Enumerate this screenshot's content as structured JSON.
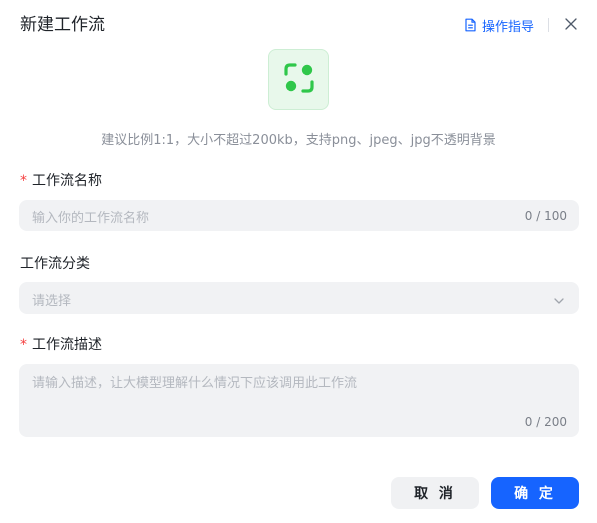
{
  "header": {
    "title": "新建工作流",
    "guide_label": "操作指导"
  },
  "icon": {
    "hint": "建议比例1:1，大小不超过200kb，支持png、jpeg、jpg不透明背景"
  },
  "form": {
    "required_mark": "*",
    "name": {
      "label": "工作流名称",
      "placeholder": "输入你的工作流名称",
      "counter": "0 / 100"
    },
    "category": {
      "label": "工作流分类",
      "placeholder": "请选择"
    },
    "description": {
      "label": "工作流描述",
      "placeholder": "请输入描述，让大模型理解什么情况下应该调用此工作流",
      "counter": "0 / 200"
    }
  },
  "footer": {
    "cancel_label": "取 消",
    "confirm_label": "确 定"
  },
  "colors": {
    "primary": "#1664ff",
    "required": "#f53f3f",
    "icon_green": "#2fc74a",
    "field_bg": "#f1f2f4"
  }
}
